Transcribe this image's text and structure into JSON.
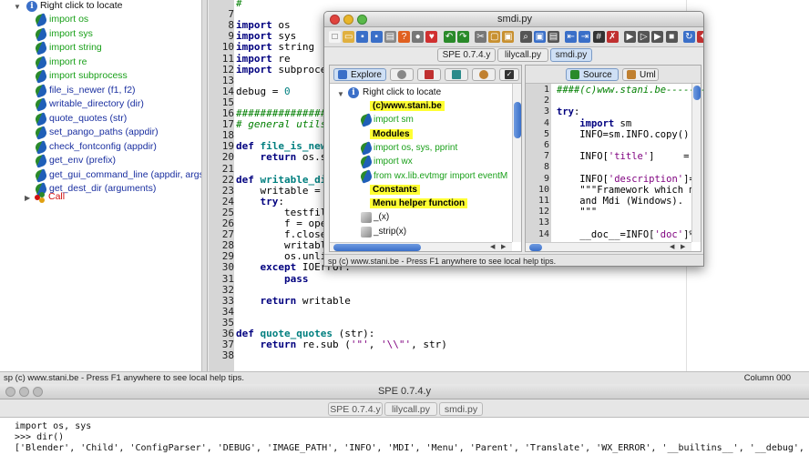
{
  "left_tree": {
    "root_label": "Right click to locate",
    "items": [
      {
        "label": "import os",
        "kind": "import"
      },
      {
        "label": "import sys",
        "kind": "import"
      },
      {
        "label": "import string",
        "kind": "import"
      },
      {
        "label": "import re",
        "kind": "import"
      },
      {
        "label": "import subprocess",
        "kind": "import"
      },
      {
        "label": "file_is_newer (f1, f2)",
        "kind": "function"
      },
      {
        "label": "writable_directory (dir)",
        "kind": "function"
      },
      {
        "label": "quote_quotes (str)",
        "kind": "function"
      },
      {
        "label": "set_pango_paths (appdir)",
        "kind": "function"
      },
      {
        "label": "check_fontconfig (appdir)",
        "kind": "function"
      },
      {
        "label": "get_env (prefix)",
        "kind": "function"
      },
      {
        "label": "get_gui_command_line (appdir, args)",
        "kind": "function"
      },
      {
        "label": "get_dest_dir (arguments)",
        "kind": "function"
      }
    ],
    "call_label": "Call"
  },
  "editor": {
    "lines": [
      {
        "n": "",
        "code": "#"
      },
      {
        "n": "7",
        "code": ""
      },
      {
        "n": "8",
        "code": "import os"
      },
      {
        "n": "9",
        "code": "import sys"
      },
      {
        "n": "10",
        "code": "import string"
      },
      {
        "n": "11",
        "code": "import re"
      },
      {
        "n": "12",
        "code": "import subprocess"
      },
      {
        "n": "13",
        "code": ""
      },
      {
        "n": "14",
        "code": "debug = 0"
      },
      {
        "n": "15",
        "code": ""
      },
      {
        "n": "16",
        "code": "##########################"
      },
      {
        "n": "17",
        "code": "# general utils"
      },
      {
        "n": "18",
        "code": ""
      },
      {
        "n": "19",
        "code": "def file_is_newer"
      },
      {
        "n": "20",
        "code": "    return os.st"
      },
      {
        "n": "21",
        "code": ""
      },
      {
        "n": "22",
        "code": "def writable_dire"
      },
      {
        "n": "23",
        "code": "    writable = 0"
      },
      {
        "n": "24",
        "code": "    try:"
      },
      {
        "n": "25",
        "code": "        testfile"
      },
      {
        "n": "26",
        "code": "        f = open"
      },
      {
        "n": "27",
        "code": "        f.close("
      },
      {
        "n": "28",
        "code": "        writable"
      },
      {
        "n": "29",
        "code": "        os.unlin"
      },
      {
        "n": "30",
        "code": "    except IOError:"
      },
      {
        "n": "31",
        "code": "        pass"
      },
      {
        "n": "32",
        "code": ""
      },
      {
        "n": "33",
        "code": "    return writable"
      },
      {
        "n": "34",
        "code": ""
      },
      {
        "n": "35",
        "code": ""
      },
      {
        "n": "36",
        "code": "def quote_quotes (str):"
      },
      {
        "n": "37",
        "code": "    return re.sub ('\"', '\\\\\"', str)"
      },
      {
        "n": "38",
        "code": ""
      }
    ]
  },
  "status_main": {
    "text": "sp  (c) www.stani.be - Press F1 anywhere to see local help tips.",
    "column": "Column 000"
  },
  "bottom_window": {
    "title": "SPE 0.7.4.y",
    "tabs": [
      "SPE 0.7.4.y",
      "lilycall.py",
      "smdi.py"
    ],
    "console_lines": [
      "import os, sys",
      ">>> dir()",
      "['Blender', 'Child', 'ConfigParser', 'DEBUG', 'IMAGE_PATH', 'INFO', 'MDI', 'Menu', 'Parent', 'Translate', 'WX_ERROR', '__builtins__', '__debug', '__doc__', '__file__', '__name__', '_shortcuts', 'app',"
    ]
  },
  "float_window": {
    "title": "smdi.py",
    "tabs": [
      "SPE 0.7.4.y",
      "lilycall.py",
      "smdi.py"
    ],
    "active_tab": 2,
    "explore": {
      "tab_label": "Explore",
      "root_label": "Right click to locate",
      "items": [
        {
          "label": "(c)www.stani.be",
          "style": "highlight"
        },
        {
          "label": "import sm",
          "style": "link"
        },
        {
          "label": "Modules",
          "style": "highlight"
        },
        {
          "label": "import  os, sys, pprint",
          "style": "link"
        },
        {
          "label": "import  wx",
          "style": "link"
        },
        {
          "label": "from    wx.lib.evtmgr import eventM",
          "style": "link"
        },
        {
          "label": "Constants",
          "style": "highlight"
        },
        {
          "label": "Menu helper function",
          "style": "highlight"
        },
        {
          "label": "_(x)",
          "style": "func"
        },
        {
          "label": "_strip(x)",
          "style": "func"
        }
      ]
    },
    "source": {
      "tab_label": "Source",
      "uml_label": "Uml",
      "lines": [
        {
          "n": "1",
          "code": "####(c)www.stani.be-------"
        },
        {
          "n": "2",
          "code": ""
        },
        {
          "n": "3",
          "code": "try:"
        },
        {
          "n": "4",
          "code": "    import sm"
        },
        {
          "n": "5",
          "code": "    INFO=sm.INFO.copy()"
        },
        {
          "n": "6",
          "code": ""
        },
        {
          "n": "7",
          "code": "    INFO['title']     = I"
        },
        {
          "n": "8",
          "code": ""
        },
        {
          "n": "9",
          "code": "    INFO['description']=\""
        },
        {
          "n": "10",
          "code": "    \"\"\"Framework which mo"
        },
        {
          "n": "11",
          "code": "    and Mdi (Windows)."
        },
        {
          "n": "12",
          "code": "    \"\"\""
        },
        {
          "n": "13",
          "code": ""
        },
        {
          "n": "14",
          "code": "    __doc__=INFO['doc']%I"
        }
      ]
    },
    "status": "sp  (c) www.stani.be - Press F1 anywhere to see local help tips."
  },
  "colors": {
    "highlight": "#ffff33",
    "import_green": "#1aa01a",
    "function_blue": "#1a2fa0",
    "call_red": "#d01010",
    "scroll_blue": "#3a6fc8"
  }
}
